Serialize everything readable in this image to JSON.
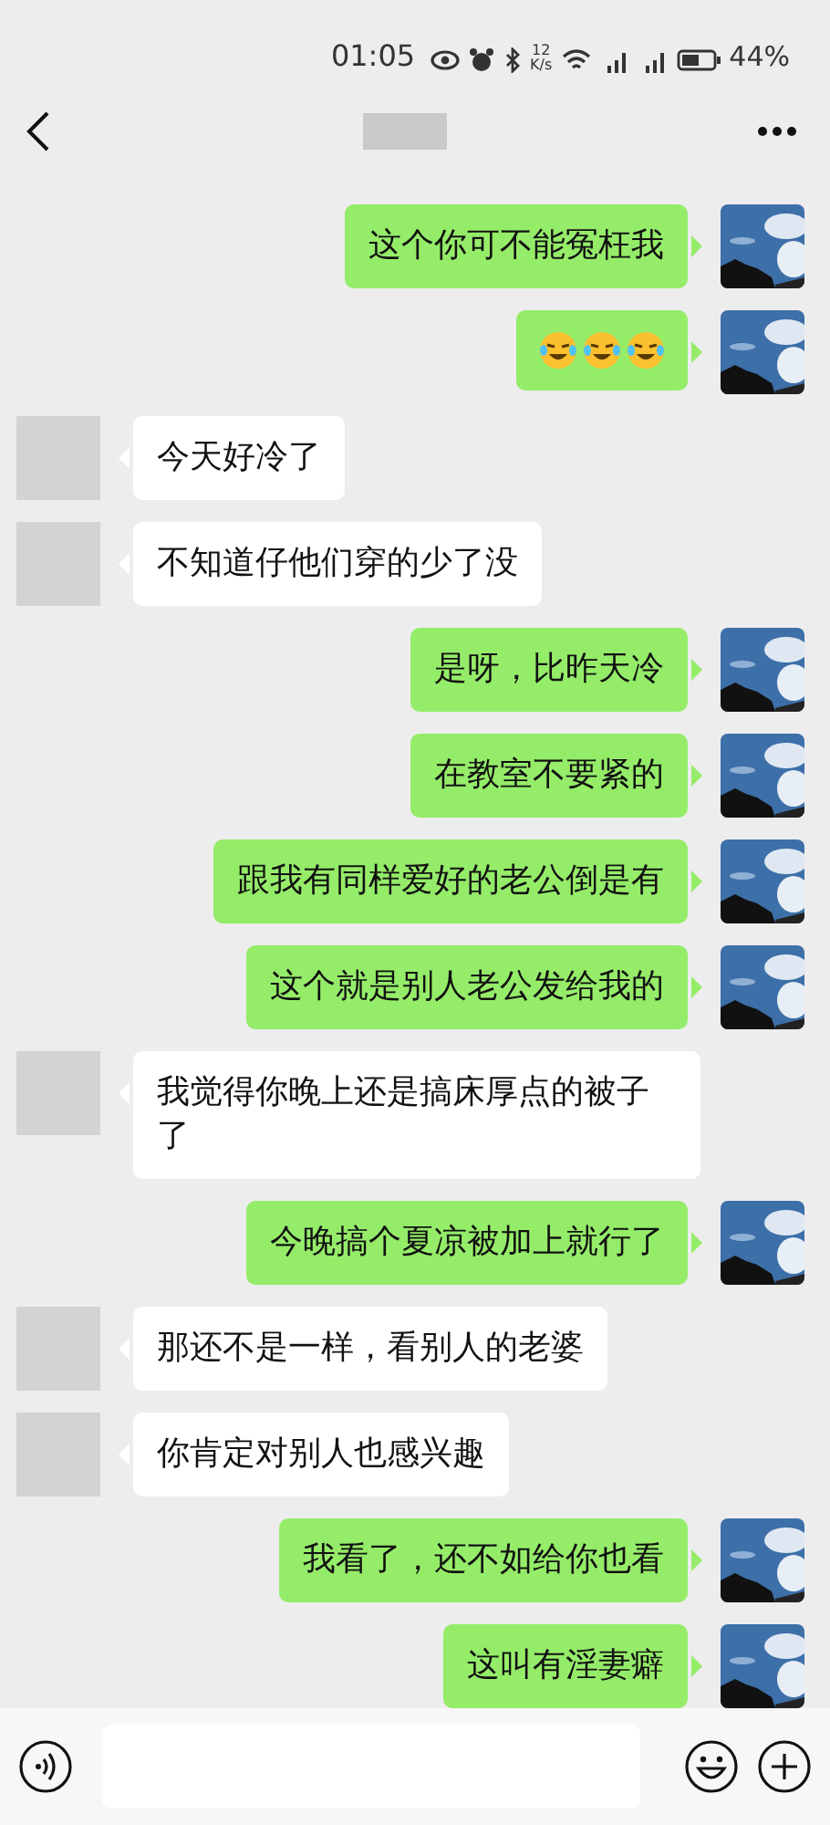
{
  "status_bar": {
    "time": "01:05",
    "speed_value": "12",
    "speed_unit": "K/s",
    "battery": "44%"
  },
  "messages": [
    {
      "outgoing": true,
      "kind": "text",
      "text": "这个你可不能冤枉我"
    },
    {
      "outgoing": true,
      "kind": "emoji",
      "emojis": [
        {
          "kind": "laughing"
        },
        {
          "kind": "laughing"
        },
        {
          "kind": "laughing"
        }
      ]
    },
    {
      "outgoing": false,
      "kind": "text",
      "text": "今天好冷了"
    },
    {
      "outgoing": false,
      "kind": "text",
      "text": "不知道仔他们穿的少了没"
    },
    {
      "outgoing": true,
      "kind": "text",
      "text": "是呀，比昨天冷"
    },
    {
      "outgoing": true,
      "kind": "text",
      "text": "在教室不要紧的"
    },
    {
      "outgoing": true,
      "kind": "text",
      "text": "跟我有同样爱好的老公倒是有"
    },
    {
      "outgoing": true,
      "kind": "text",
      "text": "这个就是别人老公发给我的"
    },
    {
      "outgoing": false,
      "kind": "text",
      "text": "我觉得你晚上还是搞床厚点的被子了"
    },
    {
      "outgoing": true,
      "kind": "text",
      "text": "今晚搞个夏凉被加上就行了"
    },
    {
      "outgoing": false,
      "kind": "text",
      "text": "那还不是一样，看别人的老婆"
    },
    {
      "outgoing": false,
      "kind": "text",
      "text": "你肯定对别人也感兴趣"
    },
    {
      "outgoing": true,
      "kind": "text",
      "text": "我看了，还不如给你也看"
    },
    {
      "outgoing": true,
      "kind": "text",
      "text": "这叫有淫妻癖"
    }
  ]
}
